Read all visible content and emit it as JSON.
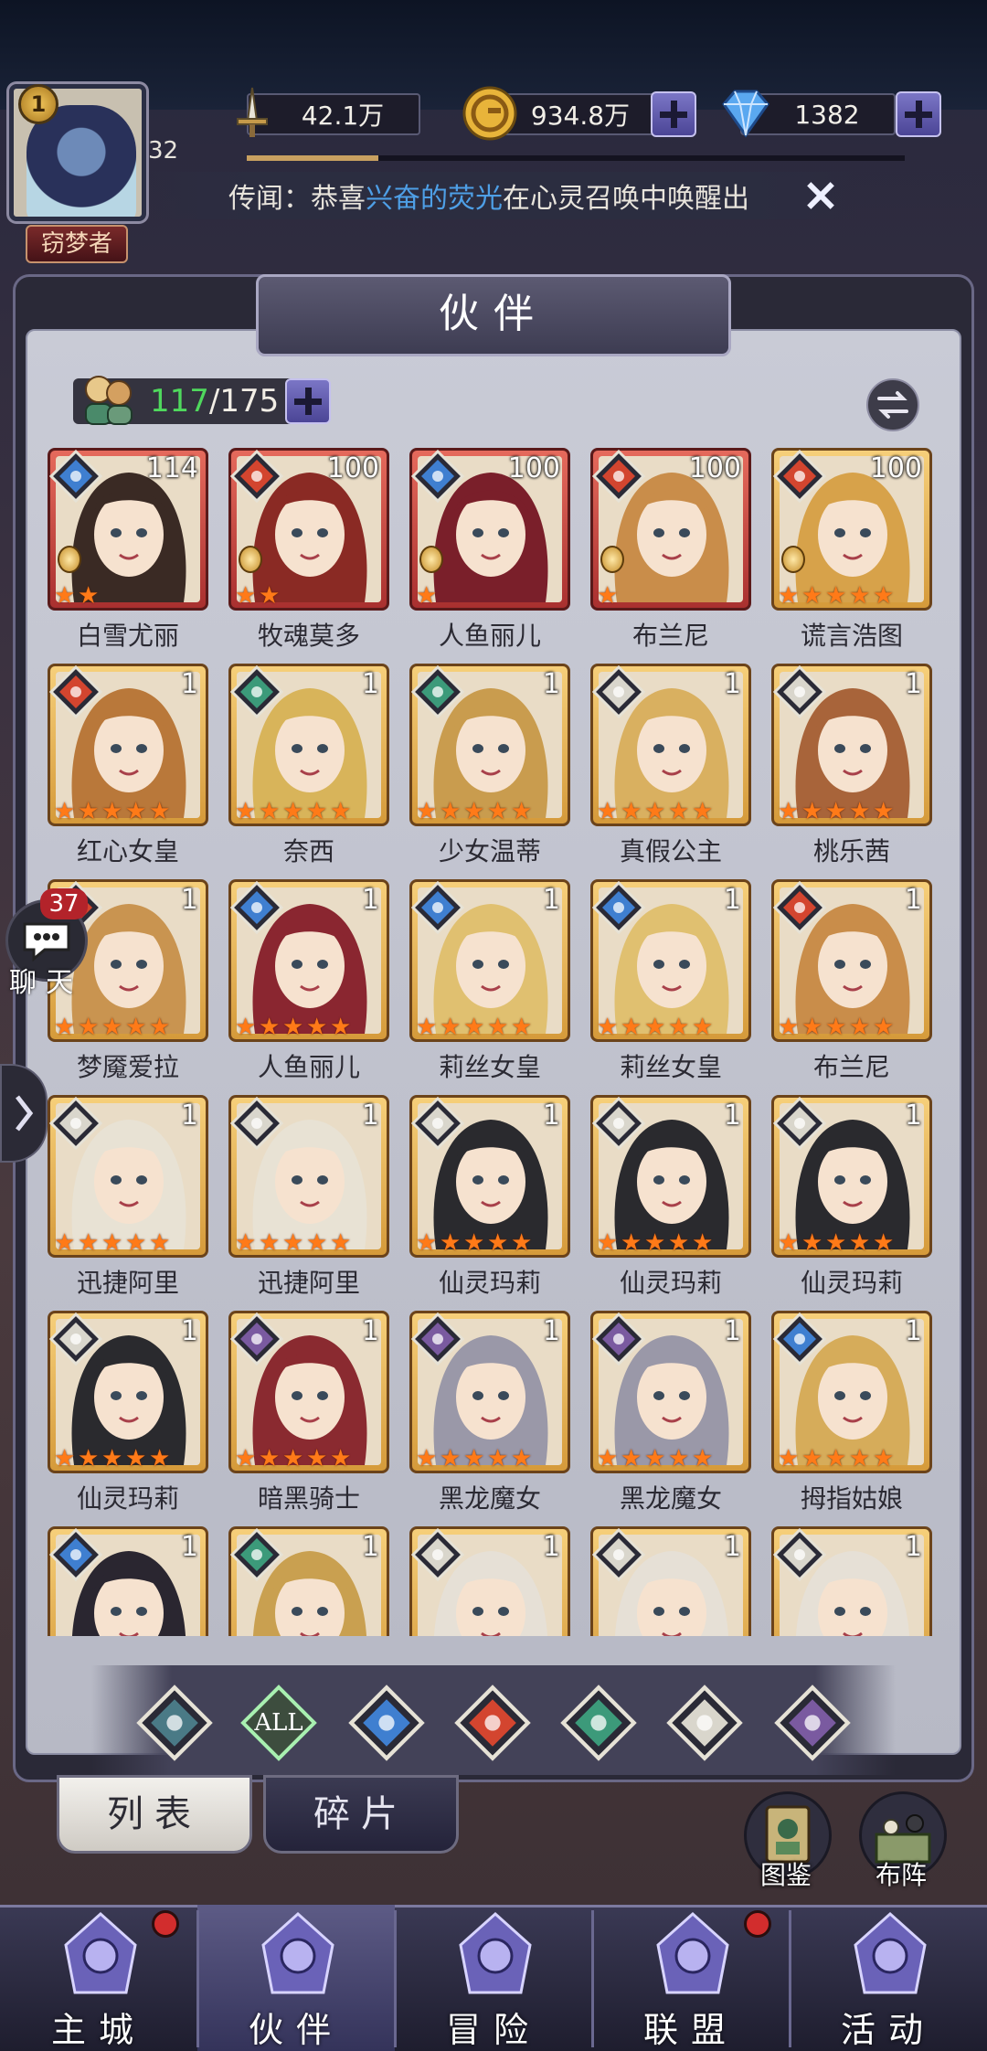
{
  "player": {
    "vip_level": "1",
    "level": "32",
    "title": "窃梦者"
  },
  "resources": {
    "power": "42.1万",
    "gold": "934.8万",
    "gems": "1382"
  },
  "exp_progress": 0.2,
  "rumor": {
    "prefix": "传闻：恭喜",
    "highlight": "兴奋的荧光",
    "suffix": "在心灵召唤中唤醒出"
  },
  "panel": {
    "title": "伙伴",
    "count_current": "117",
    "count_sep": "/",
    "count_max": "175"
  },
  "heroes": [
    {
      "name": "白雪尤丽",
      "count": "114",
      "stars": 2,
      "element": "water",
      "frame": "red",
      "medal": true,
      "hair": "#3a2a24"
    },
    {
      "name": "牧魂莫多",
      "count": "100",
      "stars": 2,
      "element": "fire",
      "frame": "red",
      "medal": true,
      "hair": "#8a2a24"
    },
    {
      "name": "人鱼丽儿",
      "count": "100",
      "stars": 1,
      "element": "water",
      "frame": "red",
      "medal": true,
      "hair": "#7a1f2a"
    },
    {
      "name": "布兰尼",
      "count": "100",
      "stars": 1,
      "element": "fire",
      "frame": "red",
      "medal": true,
      "hair": "#c98d4a"
    },
    {
      "name": "谎言浩图",
      "count": "100",
      "stars": 5,
      "element": "fire",
      "frame": "gold",
      "medal": true,
      "hair": "#d7a24a"
    },
    {
      "name": "红心女皇",
      "count": "1",
      "stars": 5,
      "element": "fire",
      "frame": "gold",
      "medal": false,
      "hair": "#b9783a"
    },
    {
      "name": "奈西",
      "count": "1",
      "stars": 5,
      "element": "wind",
      "frame": "gold",
      "medal": false,
      "hair": "#d8b45a"
    },
    {
      "name": "少女温蒂",
      "count": "1",
      "stars": 5,
      "element": "wind",
      "frame": "gold",
      "medal": false,
      "hair": "#c99c4e"
    },
    {
      "name": "真假公主",
      "count": "1",
      "stars": 5,
      "element": "light",
      "frame": "gold",
      "medal": false,
      "hair": "#d9b060"
    },
    {
      "name": "桃乐茜",
      "count": "1",
      "stars": 5,
      "element": "light",
      "frame": "gold",
      "medal": false,
      "hair": "#a8643a"
    },
    {
      "name": "梦魇爱拉",
      "count": "1",
      "stars": 5,
      "element": "fire",
      "frame": "gold",
      "medal": false,
      "hair": "#c99450"
    },
    {
      "name": "人鱼丽儿",
      "count": "1",
      "stars": 5,
      "element": "water",
      "frame": "gold",
      "medal": false,
      "hair": "#8a2630"
    },
    {
      "name": "莉丝女皇",
      "count": "1",
      "stars": 5,
      "element": "water",
      "frame": "gold",
      "medal": false,
      "hair": "#e0c070"
    },
    {
      "name": "莉丝女皇",
      "count": "1",
      "stars": 5,
      "element": "water",
      "frame": "gold",
      "medal": false,
      "hair": "#e0c070"
    },
    {
      "name": "布兰尼",
      "count": "1",
      "stars": 5,
      "element": "fire",
      "frame": "gold",
      "medal": false,
      "hair": "#c98d4a"
    },
    {
      "name": "迅捷阿里",
      "count": "1",
      "stars": 5,
      "element": "light",
      "frame": "gold",
      "medal": false,
      "hair": "#e8e2d4"
    },
    {
      "name": "迅捷阿里",
      "count": "1",
      "stars": 5,
      "element": "light",
      "frame": "gold",
      "medal": false,
      "hair": "#e8e2d4"
    },
    {
      "name": "仙灵玛莉",
      "count": "1",
      "stars": 5,
      "element": "light",
      "frame": "gold",
      "medal": false,
      "hair": "#2a2a2e"
    },
    {
      "name": "仙灵玛莉",
      "count": "1",
      "stars": 5,
      "element": "light",
      "frame": "gold",
      "medal": false,
      "hair": "#2a2a2e"
    },
    {
      "name": "仙灵玛莉",
      "count": "1",
      "stars": 5,
      "element": "light",
      "frame": "gold",
      "medal": false,
      "hair": "#2a2a2e"
    },
    {
      "name": "仙灵玛莉",
      "count": "1",
      "stars": 5,
      "element": "light",
      "frame": "gold",
      "medal": false,
      "hair": "#2a2a2e"
    },
    {
      "name": "暗黑骑士",
      "count": "1",
      "stars": 5,
      "element": "dark",
      "frame": "gold",
      "medal": false,
      "hair": "#8a2a30"
    },
    {
      "name": "黑龙魔女",
      "count": "1",
      "stars": 5,
      "element": "dark",
      "frame": "gold",
      "medal": false,
      "hair": "#9a98a8"
    },
    {
      "name": "黑龙魔女",
      "count": "1",
      "stars": 5,
      "element": "dark",
      "frame": "gold",
      "medal": false,
      "hair": "#9a98a8"
    },
    {
      "name": "拇指姑娘",
      "count": "1",
      "stars": 5,
      "element": "water",
      "frame": "gold",
      "medal": false,
      "hair": "#d6ac5a"
    },
    {
      "name": "",
      "count": "1",
      "stars": 0,
      "element": "water",
      "frame": "gold",
      "medal": false,
      "hair": "#2a2630"
    },
    {
      "name": "",
      "count": "1",
      "stars": 0,
      "element": "wind",
      "frame": "gold",
      "medal": false,
      "hair": "#c9a050"
    },
    {
      "name": "",
      "count": "1",
      "stars": 0,
      "element": "light",
      "frame": "gold",
      "medal": false,
      "hair": "#e6e0d6"
    },
    {
      "name": "",
      "count": "1",
      "stars": 0,
      "element": "light",
      "frame": "gold",
      "medal": false,
      "hair": "#e6e0d6"
    },
    {
      "name": "",
      "count": "1",
      "stars": 0,
      "element": "light",
      "frame": "gold",
      "medal": false,
      "hair": "#e6e0d6"
    }
  ],
  "element_colors": {
    "water": "#3f7fd0",
    "fire": "#d3452f",
    "wind": "#3c9a7a",
    "light": "#d9d6cc",
    "dark": "#7a5aa0",
    "nature": "#4a7a86"
  },
  "filters": [
    {
      "id": "nature",
      "label": ""
    },
    {
      "id": "all",
      "label": "ALL"
    },
    {
      "id": "water",
      "label": ""
    },
    {
      "id": "fire",
      "label": ""
    },
    {
      "id": "wind",
      "label": ""
    },
    {
      "id": "light",
      "label": ""
    },
    {
      "id": "dark",
      "label": ""
    }
  ],
  "subtabs": {
    "list": "列表",
    "shards": "碎片"
  },
  "side": {
    "codex": "图鉴",
    "formation": "布阵"
  },
  "chat": {
    "badge": "37",
    "label": "聊天"
  },
  "nav": [
    {
      "label": "主城",
      "icon": "castle-icon",
      "dot": true
    },
    {
      "label": "伙伴",
      "icon": "witch-hat-icon",
      "dot": false
    },
    {
      "label": "冒险",
      "icon": "compass-icon",
      "dot": false
    },
    {
      "label": "联盟",
      "icon": "shield-icon",
      "dot": true
    },
    {
      "label": "活动",
      "icon": "cards-icon",
      "dot": false
    }
  ]
}
